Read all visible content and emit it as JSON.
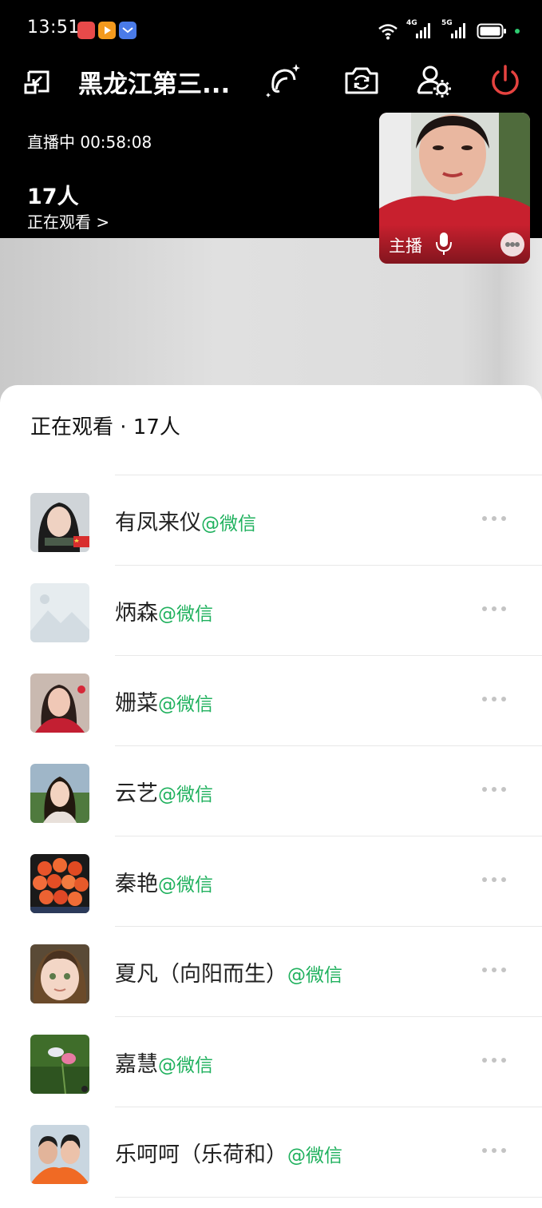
{
  "status": {
    "time": "13:51",
    "net1": "4G",
    "net2": "5G"
  },
  "header": {
    "title": "黑龙江第三...",
    "live_text": "直播中 00:58:08",
    "viewer_count": "17人",
    "watching_link": "正在观看 >"
  },
  "pip": {
    "label": "主播"
  },
  "sheet": {
    "title": "正在观看 · 17人"
  },
  "viewers": [
    {
      "name": "有凤来仪",
      "source": "@微信"
    },
    {
      "name": "炳森",
      "source": "@微信"
    },
    {
      "name": "姗菜",
      "source": "@微信"
    },
    {
      "name": "云艺",
      "source": "@微信"
    },
    {
      "name": "秦艳",
      "source": "@微信"
    },
    {
      "name": "夏凡（向阳而生）",
      "source": "@微信"
    },
    {
      "name": "嘉慧",
      "source": "@微信"
    },
    {
      "name": "乐呵呵（乐荷和）",
      "source": "@微信"
    }
  ],
  "colors": {
    "wechat_green": "#20b15e",
    "power_red": "#e64340",
    "online_dot": "#2ecc71"
  }
}
